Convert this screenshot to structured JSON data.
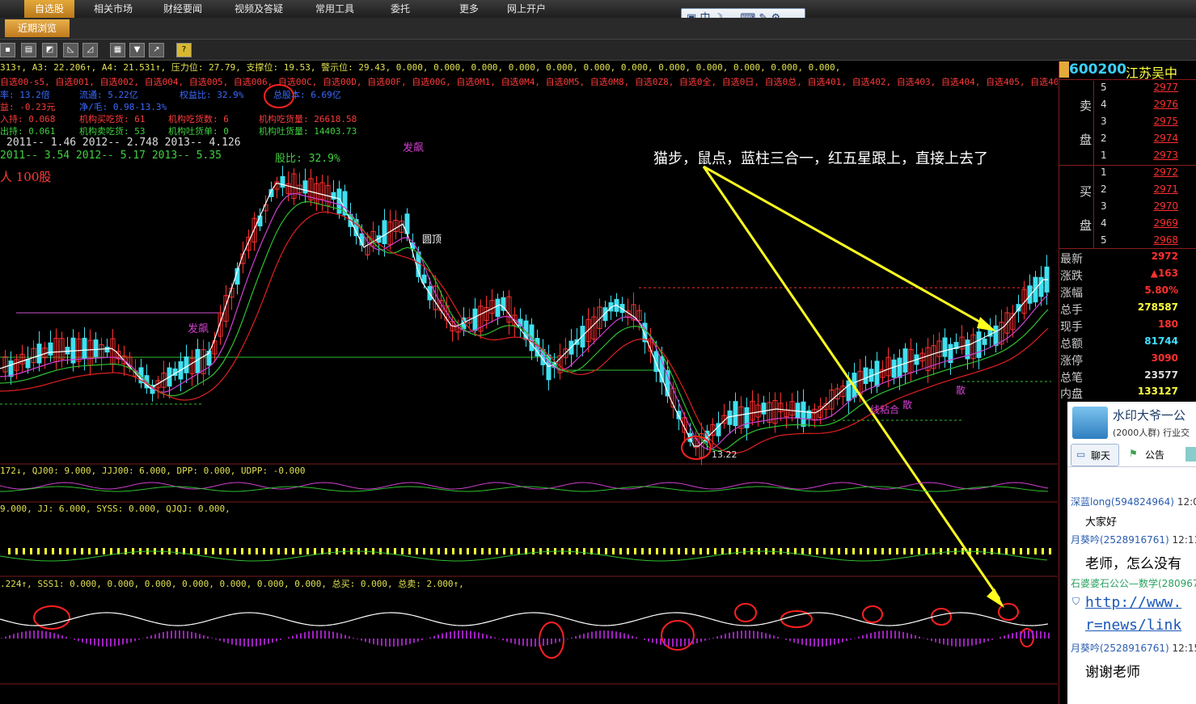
{
  "menu": {
    "items": [
      "自选股",
      "相关市场",
      "财经要闻",
      "视频及答疑",
      "常用工具",
      "委托",
      "更多",
      "网上开户"
    ],
    "active": "自选股"
  },
  "subtab": "近期浏览",
  "ime_bar": {
    "lang": "中"
  },
  "info": {
    "line1": "313↑, A3: 22.206↑, A4: 21.531↑, 压力位: 27.79, 支撑位: 19.53, 警示位: 29.43, 0.000, 0.000, 0.000, 0.000, 0.000, 0.000, 0.000, 0.000, 0.000, 0.000, 0.000, 0.000,",
    "line2": "自选00-s5, 自选001, 自选002, 自选004, 自选005, 自选006, 自选00C, 自选00D, 自选00F, 自选00G, 自选0M1, 自选0M4, 自选0M5, 自选0M8, 自选0Z8, 自选0全, 自选0日, 自选0总, 自选401, 自选402, 自选403, 自选404, 自选405, 自选40A, 自选501, 自选502, 自选504, 自",
    "rows": [
      {
        "a": "率: 13.2倍",
        "b": "流通: 5.22亿",
        "c": "权益比: 32.9%",
        "d": "总股本: 6.69亿"
      },
      {
        "a": "益: -0.23元",
        "b": "净/毛: 0.98-13.3%",
        "c": "",
        "d": ""
      },
      {
        "a": "入持: 0.068",
        "b": "机构买吃货: 61",
        "c": "机构吃货数: 6",
        "d": "机构吃货量: 26618.58"
      },
      {
        "a": "出持: 0.061",
        "b": "机构卖吃货: 53",
        "c": "机构吐货单: 0",
        "d": "机构吐货量: 14403.73"
      }
    ],
    "eps1": "2011-- 1.46    2012-- 2.748    2013-- 4.126",
    "eps2": "2011-- 3.54    2012-- 5.17     2013-- 5.35",
    "hold": "人 100股",
    "margin_note": "股比: 32.9%"
  },
  "annotation": "猫步，鼠点，蓝柱三合一，红五星跟上，直接上去了",
  "chart_labels": {
    "fa1": "发飙",
    "fa2": "发飙",
    "yuanding": "圆顶",
    "low": "13.22",
    "xian": "线粘合",
    "qi": "起",
    "san": "散"
  },
  "panel1": "172↓, QJ00: 9.000, JJJ00: 6.000, DPP: 0.000, UDPP: -0.000",
  "panel2": "9.000, JJ: 6.000, SYSS: 0.000, QJQJ: 0.000,",
  "panel3": ".224↑, SSS1: 0.000, 0.000, 0.000, 0.000, 0.000, 0.000, 0.000, 总买: 0.000, 总卖: 2.000↑,",
  "stock": {
    "code": "600200",
    "name": "江苏吴中"
  },
  "orderbook": {
    "sell_label": [
      "卖",
      "盘"
    ],
    "buy_label": [
      "买",
      "盘"
    ],
    "sell": [
      {
        "lvl": "5",
        "px": "2977"
      },
      {
        "lvl": "4",
        "px": "2976"
      },
      {
        "lvl": "3",
        "px": "2975"
      },
      {
        "lvl": "2",
        "px": "2974"
      },
      {
        "lvl": "1",
        "px": "2973"
      }
    ],
    "buy": [
      {
        "lvl": "1",
        "px": "2972"
      },
      {
        "lvl": "2",
        "px": "2971"
      },
      {
        "lvl": "3",
        "px": "2970"
      },
      {
        "lvl": "4",
        "px": "2969"
      },
      {
        "lvl": "5",
        "px": "2968"
      }
    ]
  },
  "quote": [
    {
      "label": "最新",
      "value": "2972",
      "color": "#ff3030"
    },
    {
      "label": "涨跌",
      "value": "▲163",
      "color": "#ff3030"
    },
    {
      "label": "涨幅",
      "value": "5.80%",
      "color": "#ff3030"
    },
    {
      "label": "总手",
      "value": "278587",
      "color": "#ffff40"
    },
    {
      "label": "现手",
      "value": "180",
      "color": "#ff3030"
    },
    {
      "label": "总额",
      "value": "81744",
      "color": "#40e0ff"
    },
    {
      "label": "涨停",
      "value": "3090",
      "color": "#ff3030"
    },
    {
      "label": "总笔",
      "value": "23577",
      "color": "#ddd"
    },
    {
      "label": "内盘",
      "value": "133127",
      "color": "#ffff40"
    }
  ],
  "chat": {
    "group": "水印大爷一公",
    "members": "(2000人群) 行业交",
    "tabs": [
      "聊天",
      "公告"
    ],
    "msgs": [
      {
        "user": "深蓝long(594824964)",
        "time": "12:0",
        "text": "大家好"
      },
      {
        "user": "月葵吟(2528916761)",
        "time": "12:11",
        "text": "老师，怎么没有"
      },
      {
        "user": "石婆婆石公公—数学(280967",
        "time": "",
        "text": "http://www."
      },
      {
        "user": "",
        "time": "",
        "text": "r=news/link"
      },
      {
        "user": "月葵吟(2528916761)",
        "time": "12:15",
        "text": "谢谢老师"
      }
    ]
  },
  "colors": {
    "up": "#ff3030",
    "down": "#40e0f0",
    "accent": "#e5a93a",
    "panel_border": "#8a1c1c"
  }
}
